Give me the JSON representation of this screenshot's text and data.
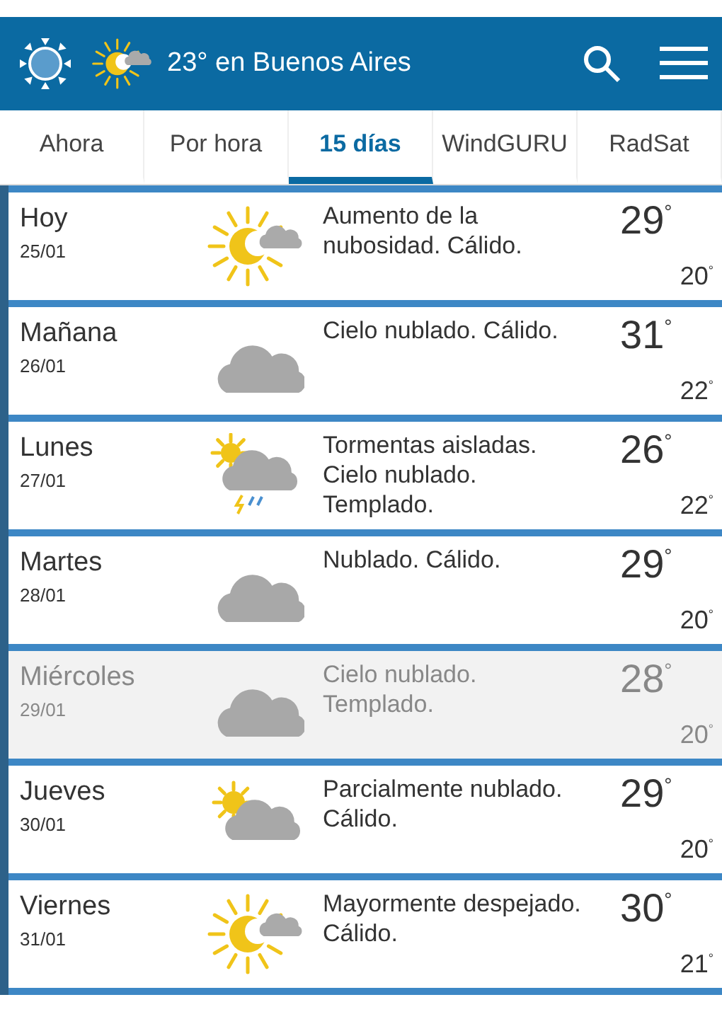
{
  "header": {
    "title": "23° en Buenos Aires",
    "kind": "sun-cloud"
  },
  "tabs": [
    {
      "label": "Ahora",
      "selected": false
    },
    {
      "label": "Por hora",
      "selected": false
    },
    {
      "label": "15 días",
      "selected": true
    },
    {
      "label": "WindGURU",
      "selected": false
    },
    {
      "label": "RadSat",
      "selected": false
    }
  ],
  "days": [
    {
      "day": "Hoy",
      "date": "25/01",
      "kind": "sun-cloud",
      "description": "Aumento de la nubosidad. Cálido.",
      "max": "29$^{°}$",
      "min": "20$^{°}$",
      "selected": false
    },
    {
      "day": "Mañana",
      "date": "26/01",
      "kind": "cloud",
      "description": "Cielo nublado. Cálido.",
      "max": "31$^{°}$",
      "min": "22$^{°}$",
      "selected": false
    },
    {
      "day": "Lunes",
      "date": "27/01",
      "kind": "storm",
      "description": "Tormentas aisladas. Cielo nublado. Templado.",
      "max": "26$^{°}$",
      "min": "22$^{°}$",
      "selected": false
    },
    {
      "day": "Martes",
      "date": "28/01",
      "kind": "cloud",
      "description": "Nublado. Cálido.",
      "max": "29$^{°}$",
      "min": "20$^{°}$",
      "selected": false
    },
    {
      "day": "Miércoles",
      "date": "29/01",
      "kind": "cloud",
      "description": "Cielo nublado. Templado.",
      "max": "28$^{°}$",
      "min": "20$^{°}$",
      "selected": true
    },
    {
      "day": "Jueves",
      "date": "30/01",
      "kind": "partly-cloudy",
      "description": "Parcialmente nublado. Cálido.",
      "max": "29$^{°}$",
      "min": "20$^{°}$",
      "selected": false
    },
    {
      "day": "Viernes",
      "date": "31/01",
      "kind": "sun-cloud",
      "description": "Mayormente despejado. Cálido.",
      "max": "30$^{°}$",
      "min": "21$^{°}$",
      "selected": false
    }
  ]
}
